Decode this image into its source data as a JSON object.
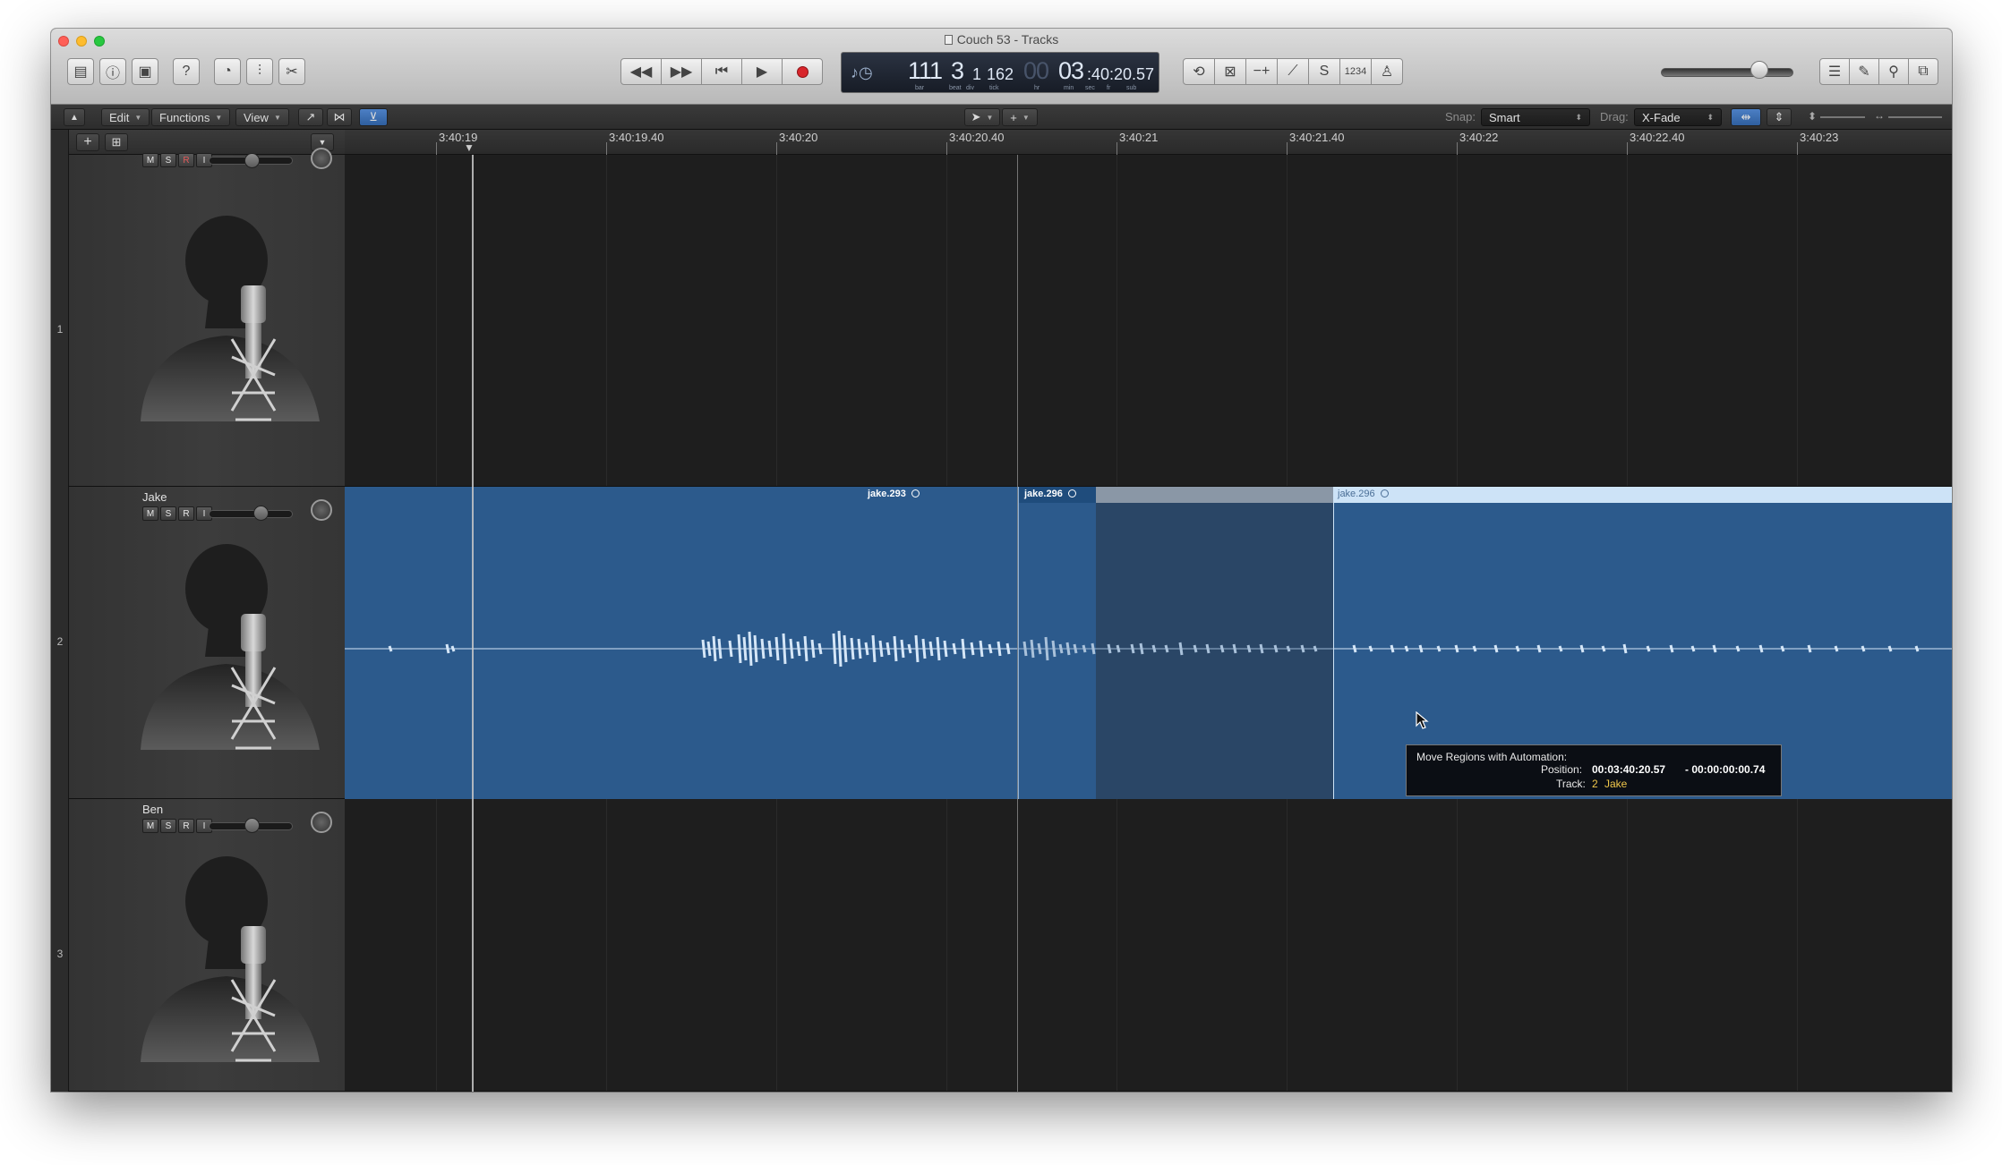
{
  "window": {
    "title": "Couch 53 - Tracks",
    "traffic_colors": {
      "close": "#ff5f57",
      "minimize": "#febc2e",
      "zoom": "#28c840"
    }
  },
  "lcd": {
    "bar": "111",
    "beat": "3",
    "div": "1",
    "tick": "162",
    "hour_label": "00",
    "hour": "03",
    "time_rest": ":40:20.57",
    "labels": {
      "bar": "bar",
      "beat": "beat",
      "div": "div",
      "tick": "tick",
      "hr": "hr",
      "min": "min",
      "sec": "sec",
      "fr": "fr",
      "sub": "sub"
    }
  },
  "toolbar": {
    "count_in_label": "1234"
  },
  "control_bar": {
    "edit": "Edit",
    "functions": "Functions",
    "view": "View",
    "snap_label": "Snap:",
    "snap_value": "Smart",
    "drag_label": "Drag:",
    "drag_value": "X-Fade"
  },
  "ruler": {
    "labels": [
      "3:40:19",
      "3:40:19.40",
      "3:40:20",
      "3:40:20.40",
      "3:40:21",
      "3:40:21.40",
      "3:40:22",
      "3:40:22.40",
      "3:40:23"
    ]
  },
  "tracks": [
    {
      "number": "1",
      "name": ""
    },
    {
      "number": "2",
      "name": "Jake"
    },
    {
      "number": "3",
      "name": "Ben"
    }
  ],
  "track_buttons": {
    "mute": "M",
    "solo": "S",
    "record": "R",
    "input": "I"
  },
  "regions": {
    "r1": "jake.293",
    "r2": "jake.296",
    "r3": "jake.296"
  },
  "tooltip": {
    "title": "Move Regions with Automation:",
    "position_label": "Position:",
    "position_value": "00:03:40:20.57",
    "delta_value": "- 00:00:00:00.74",
    "track_label": "Track:",
    "track_number": "2",
    "track_name": "Jake"
  },
  "colors": {
    "region": "#2c5a8c",
    "region_header_selected": "#cde3f7",
    "region_header": "#1f4c7c",
    "waveform": "#d5e6f7"
  }
}
